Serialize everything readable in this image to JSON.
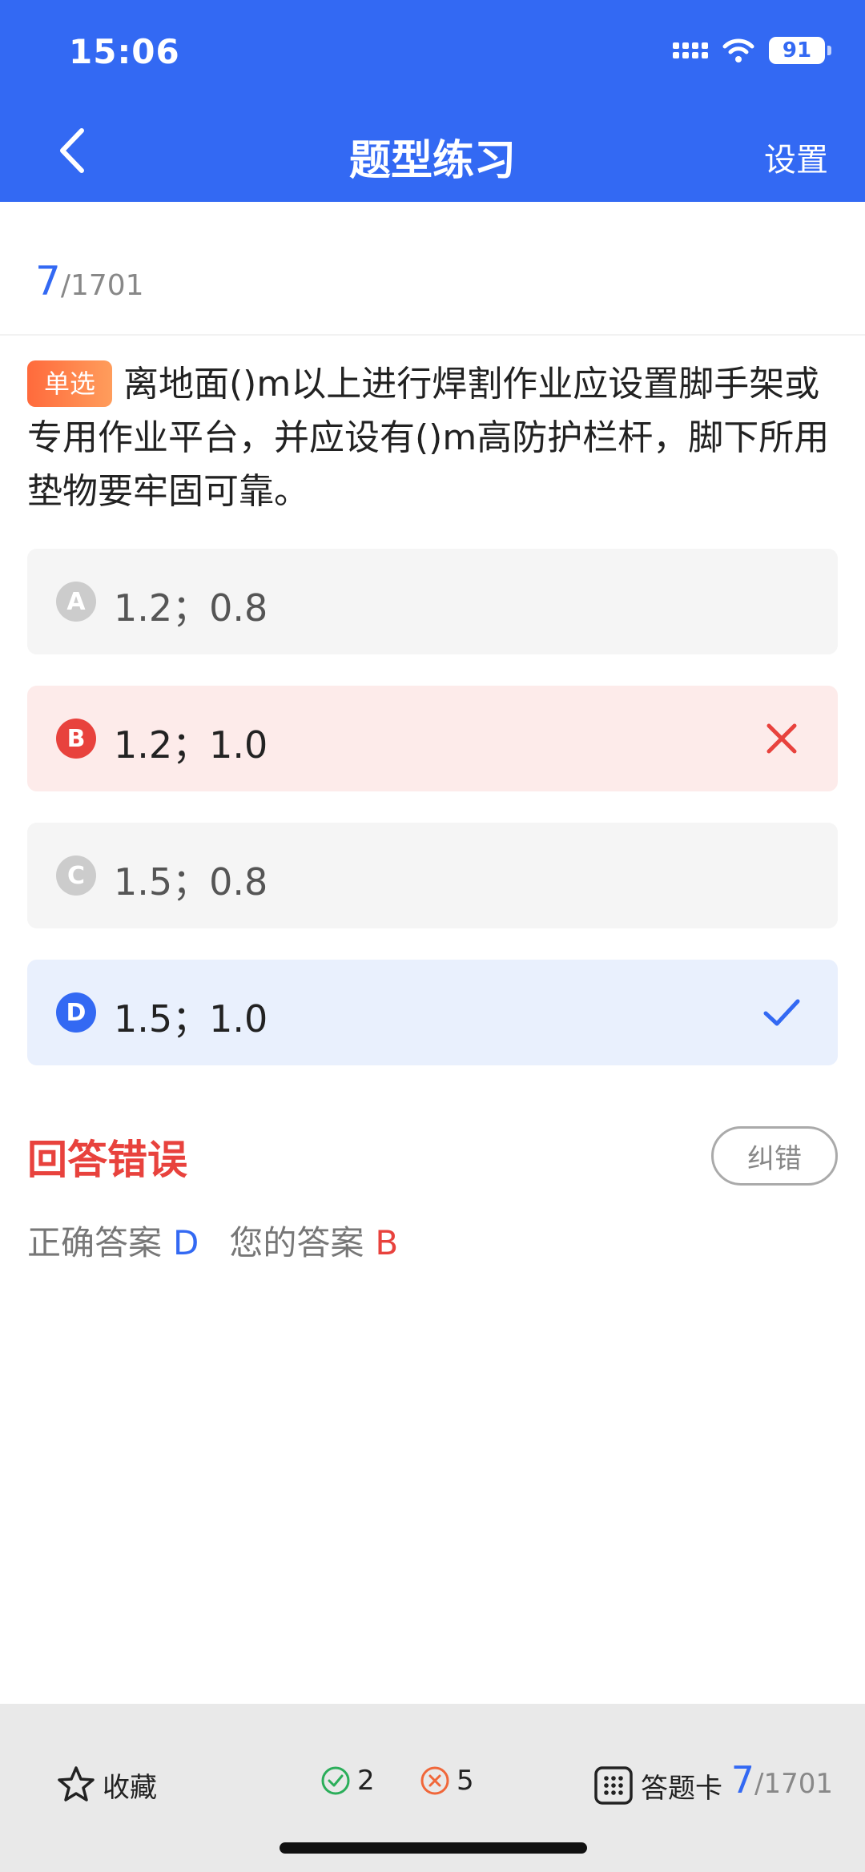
{
  "status_bar": {
    "time": "15:06",
    "battery": "91"
  },
  "nav": {
    "title": "题型练习",
    "settings_label": "设置"
  },
  "progress": {
    "current": "7",
    "total": "/1701"
  },
  "question": {
    "type_badge": "单选",
    "text": "离地面()m以上进行焊割作业应设置脚手架或专用作业平台，并应设有()m高防护栏杆，脚下所用垫物要牢固可靠。"
  },
  "options": [
    {
      "letter": "A",
      "text": "1.2；0.8",
      "state": "default"
    },
    {
      "letter": "B",
      "text": "1.2；1.0",
      "state": "wrong"
    },
    {
      "letter": "C",
      "text": "1.5；0.8",
      "state": "default"
    },
    {
      "letter": "D",
      "text": "1.5；1.0",
      "state": "correct"
    }
  ],
  "result": {
    "title": "回答错误",
    "correction_label": "纠错",
    "correct_label": "正确答案",
    "correct_value": "D",
    "yours_label": "您的答案",
    "yours_value": "B"
  },
  "bottom_bar": {
    "favorite_label": "收藏",
    "right_count": "2",
    "wrong_count": "5",
    "card_label": "答题卡",
    "progress_current": "7",
    "progress_total": "/1701"
  },
  "colors": {
    "primary": "#3369F3",
    "error": "#E8423D",
    "success": "#2BAE5A",
    "badge": "#FF7A45"
  },
  "icons": [
    "back-chevron-icon",
    "signal-icon",
    "wifi-icon",
    "battery-icon",
    "wrong-x-icon",
    "check-icon",
    "star-icon",
    "right-circle-icon",
    "wrong-circle-icon",
    "answer-card-grid-icon"
  ]
}
